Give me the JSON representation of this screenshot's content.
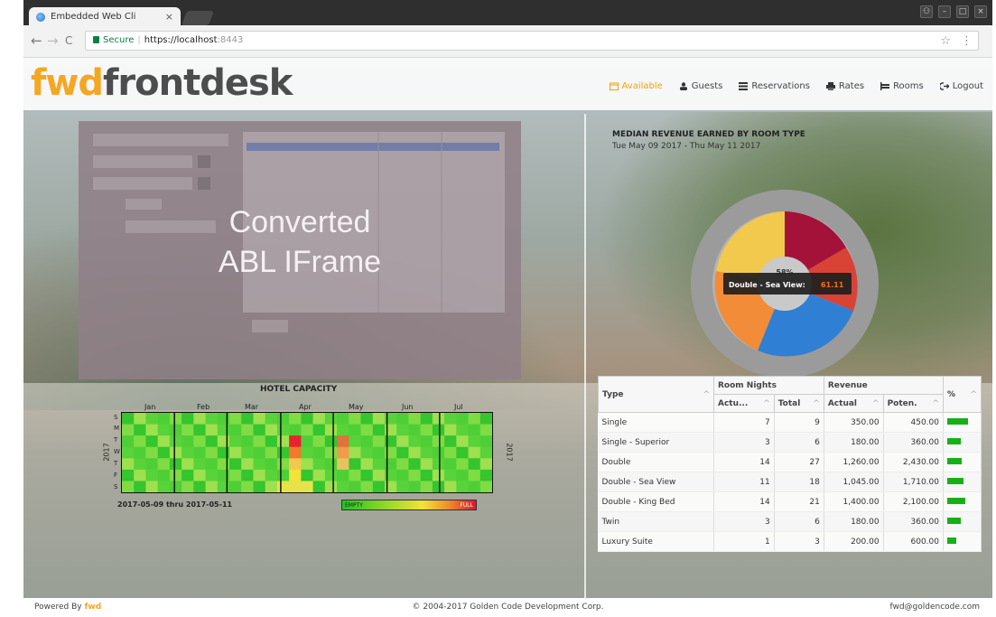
{
  "browser": {
    "tab_title": "Embedded Web Cli",
    "tab_close": "×",
    "secure_label": "Secure",
    "url": "https://localhost",
    "port": ":8443",
    "star": "☆",
    "menu": "⋮",
    "back": "←",
    "forward": "→",
    "reload": "C",
    "win_min": "–",
    "win_max": "□",
    "win_close": "×",
    "win_user": "⚇"
  },
  "app": {
    "logo_fwd": "fwd",
    "logo_front": "frontdesk",
    "nav": [
      {
        "label": "Available",
        "icon": "calendar-icon"
      },
      {
        "label": "Guests",
        "icon": "user-icon"
      },
      {
        "label": "Reservations",
        "icon": "list-icon"
      },
      {
        "label": "Rates",
        "icon": "printer-icon"
      },
      {
        "label": "Rooms",
        "icon": "bed-icon"
      },
      {
        "label": "Logout",
        "icon": "logout-icon"
      }
    ],
    "accent_color": "#f5a623"
  },
  "iframe": {
    "line1": "Converted",
    "line2": "ABL IFrame"
  },
  "heatmap": {
    "title": "HOTEL CAPACITY",
    "months": [
      "Jan",
      "Feb",
      "Mar",
      "Apr",
      "May",
      "Jun",
      "Jul"
    ],
    "days": [
      "S",
      "M",
      "T",
      "W",
      "T",
      "F",
      "S"
    ],
    "year": "2017",
    "range": "2017-05-09 thru 2017-05-11",
    "legend_low": "EMPTY",
    "legend_high": "FULL"
  },
  "revenue": {
    "title": "MEDIAN REVENUE EARNED BY ROOM TYPE",
    "subtitle": "Tue May 09 2017 - Thu May 11 2017",
    "tooltip_label": "Double - Sea View:",
    "tooltip_value": "61.11",
    "center_label": "58%"
  },
  "table": {
    "headers": {
      "type": "Type",
      "room_nights": "Room Nights",
      "revenue": "Revenue",
      "pct": "%",
      "actual_short": "Actu...",
      "total": "Total",
      "actual": "Actual",
      "poten": "Poten."
    },
    "rows": [
      {
        "type": "Single",
        "actual_n": "7",
        "total_n": "9",
        "actual_r": "350.00",
        "poten": "450.00",
        "pct": 0.78
      },
      {
        "type": "Single - Superior",
        "actual_n": "3",
        "total_n": "6",
        "actual_r": "180.00",
        "poten": "360.00",
        "pct": 0.5
      },
      {
        "type": "Double",
        "actual_n": "14",
        "total_n": "27",
        "actual_r": "1,260.00",
        "poten": "2,430.00",
        "pct": 0.52
      },
      {
        "type": "Double - Sea View",
        "actual_n": "11",
        "total_n": "18",
        "actual_r": "1,045.00",
        "poten": "1,710.00",
        "pct": 0.61
      },
      {
        "type": "Double - King Bed",
        "actual_n": "14",
        "total_n": "21",
        "actual_r": "1,400.00",
        "poten": "2,100.00",
        "pct": 0.67
      },
      {
        "type": "Twin",
        "actual_n": "3",
        "total_n": "6",
        "actual_r": "180.00",
        "poten": "360.00",
        "pct": 0.5
      },
      {
        "type": "Luxury Suite",
        "actual_n": "1",
        "total_n": "3",
        "actual_r": "200.00",
        "poten": "600.00",
        "pct": 0.33
      }
    ]
  },
  "footer": {
    "powered_by": "Powered By",
    "powered_logo": "fwd",
    "copyright": "© 2004-2017 Golden Code Development Corp.",
    "email": "fwd@goldencode.com"
  }
}
